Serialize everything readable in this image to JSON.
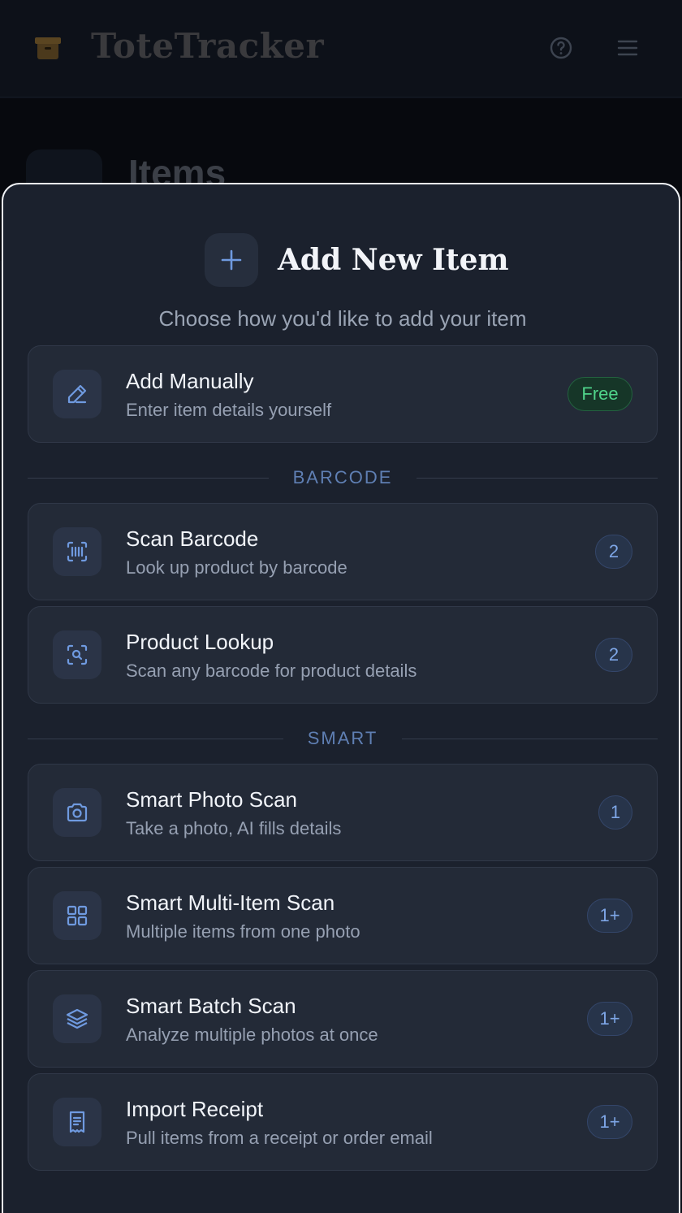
{
  "app": {
    "title": "ToteTracker",
    "page_title": "Items"
  },
  "sheet": {
    "title": "Add New Item",
    "subtitle": "Choose how you'd like to add your item",
    "manual": {
      "title": "Add Manually",
      "desc": "Enter item details yourself",
      "badge": "Free",
      "icon": "pencil-icon"
    },
    "sections": {
      "barcode": "BARCODE",
      "smart": "SMART"
    },
    "barcode_options": [
      {
        "title": "Scan Barcode",
        "desc": "Look up product by barcode",
        "badge": "2",
        "icon": "barcode-scan-icon"
      },
      {
        "title": "Product Lookup",
        "desc": "Scan any barcode for product details",
        "badge": "2",
        "icon": "search-scan-icon"
      }
    ],
    "smart_options": [
      {
        "title": "Smart Photo Scan",
        "desc": "Take a photo, AI fills details",
        "badge": "1",
        "icon": "camera-icon"
      },
      {
        "title": "Smart Multi-Item Scan",
        "desc": "Multiple items from one photo",
        "badge": "1+",
        "icon": "grid-icon"
      },
      {
        "title": "Smart Batch Scan",
        "desc": "Analyze multiple photos at once",
        "badge": "1+",
        "icon": "layers-icon"
      },
      {
        "title": "Import Receipt",
        "desc": "Pull items from a receipt or order email",
        "badge": "1+",
        "icon": "receipt-icon"
      }
    ]
  },
  "colors": {
    "accent": "#7ea6e6",
    "free_badge": "#4fd38a",
    "sheet_bg": "#1b212d",
    "card_bg": "#232a37"
  }
}
